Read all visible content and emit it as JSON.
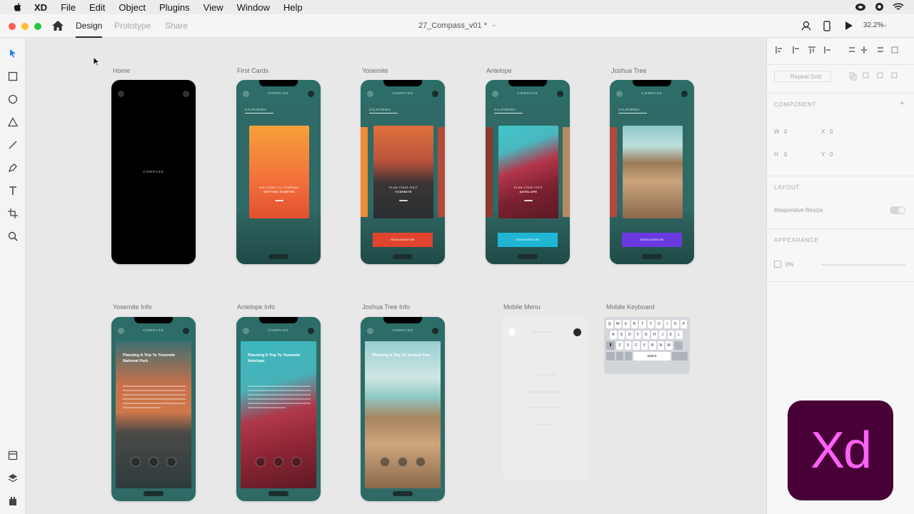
{
  "menubar": {
    "app_name": "XD",
    "items": [
      "File",
      "Edit",
      "Object",
      "Plugins",
      "View",
      "Window",
      "Help"
    ]
  },
  "appbar": {
    "tabs": [
      "Design",
      "Prototype",
      "Share"
    ],
    "active_tab": "Design",
    "document_title": "27_Compass_v01 *",
    "zoom": "32.2%"
  },
  "artboards": [
    {
      "label": "Home",
      "brand": "COMPASS"
    },
    {
      "label": "First Cards",
      "brand": "COMPASS",
      "nav": "CALIFORNIA",
      "card_sub": "WELCOME TO COMPASS",
      "card_title": "GETTING STARTED"
    },
    {
      "label": "Yosemite",
      "brand": "COMPASS",
      "nav": "CALIFORNIA",
      "card_sub": "PLAN YOUR VISIT",
      "card_title": "YOSEMITE",
      "cta": "BEGIN ADVENTURE"
    },
    {
      "label": "Antelope",
      "brand": "COMPASS",
      "nav": "CALIFORNIA",
      "card_sub": "PLAN YOUR VISIT",
      "card_title": "ANTELOPE",
      "cta": "BEGIN ADVENTURE"
    },
    {
      "label": "Joshua Tree",
      "brand": "COMPASS",
      "nav": "CALIFORNIA",
      "cta": "BEGIN ADVENTURE"
    },
    {
      "label": "Yosemite Info",
      "brand": "COMPASS",
      "title": "Planning A Trip To Yosemite National Park"
    },
    {
      "label": "Antelope Info",
      "brand": "COMPASS",
      "title": "Planning A Trip To Yosemite Antelope"
    },
    {
      "label": "Joshua Tree Info",
      "brand": "COMPASS",
      "title": "Planning A Trip To Joshua Tree"
    },
    {
      "label": "Mobile Menu"
    },
    {
      "label": "Mobile Keyboard"
    }
  ],
  "keyboard": {
    "row1": [
      "Q",
      "W",
      "E",
      "R",
      "T",
      "Y",
      "U",
      "I",
      "O",
      "P"
    ],
    "row2": [
      "A",
      "S",
      "D",
      "F",
      "G",
      "H",
      "J",
      "K",
      "L"
    ],
    "row3": [
      "Z",
      "X",
      "C",
      "V",
      "B",
      "N",
      "M"
    ],
    "space": "space"
  },
  "panel": {
    "repeat_grid": "Repeat Grid",
    "component": "COMPONENT",
    "w": "W",
    "w_val": "0",
    "x": "X",
    "x_val": "0",
    "h": "H",
    "h_val": "0",
    "y": "Y",
    "y_val": "0",
    "layout": "LAYOUT",
    "responsive_resize": "Responsive Resize",
    "appearance": "APPEARANCE",
    "opacity": "0%"
  },
  "logo": {
    "text": "Xd"
  },
  "colors": {
    "teal": "#2c6d68",
    "orange_card": "#f06a3a",
    "red_cta": "#e0442e",
    "cyan_cta": "#1fb6d4",
    "purple_cta": "#6a3ae0",
    "xd_bg": "#470137",
    "xd_fg": "#ff61f6"
  }
}
